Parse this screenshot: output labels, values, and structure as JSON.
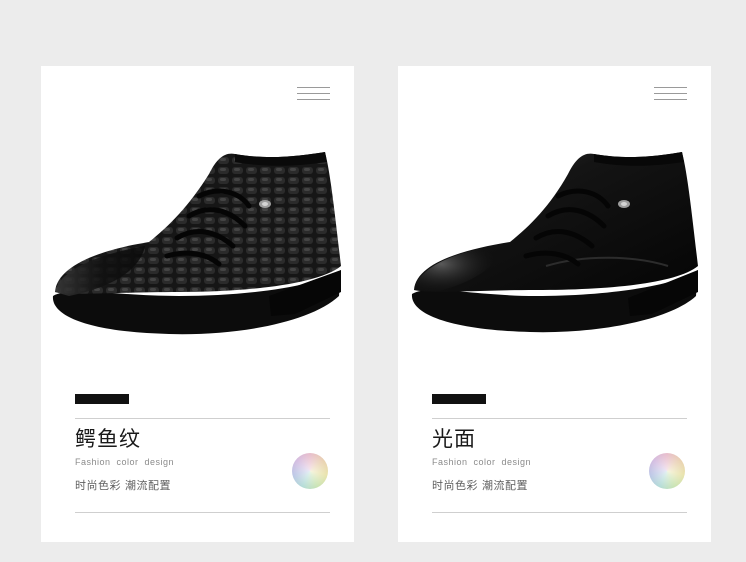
{
  "cards": [
    {
      "title": "鳄鱼纹",
      "subtitle_en": "Fashion  color  design",
      "subtitle_cn": "时尚色彩  潮流配置",
      "finish": "crocodile-pattern",
      "accent": "#111111"
    },
    {
      "title": "光面",
      "subtitle_en": "Fashion  color  design",
      "subtitle_cn": "时尚色彩  潮流配置",
      "finish": "smooth-leather",
      "accent": "#111111"
    }
  ],
  "colors": {
    "background": "#ececec",
    "card": "#ffffff",
    "shoe": "#141414"
  },
  "icons": [
    "menu-lines-icon",
    "color-wheel-icon",
    "shoe-image"
  ]
}
